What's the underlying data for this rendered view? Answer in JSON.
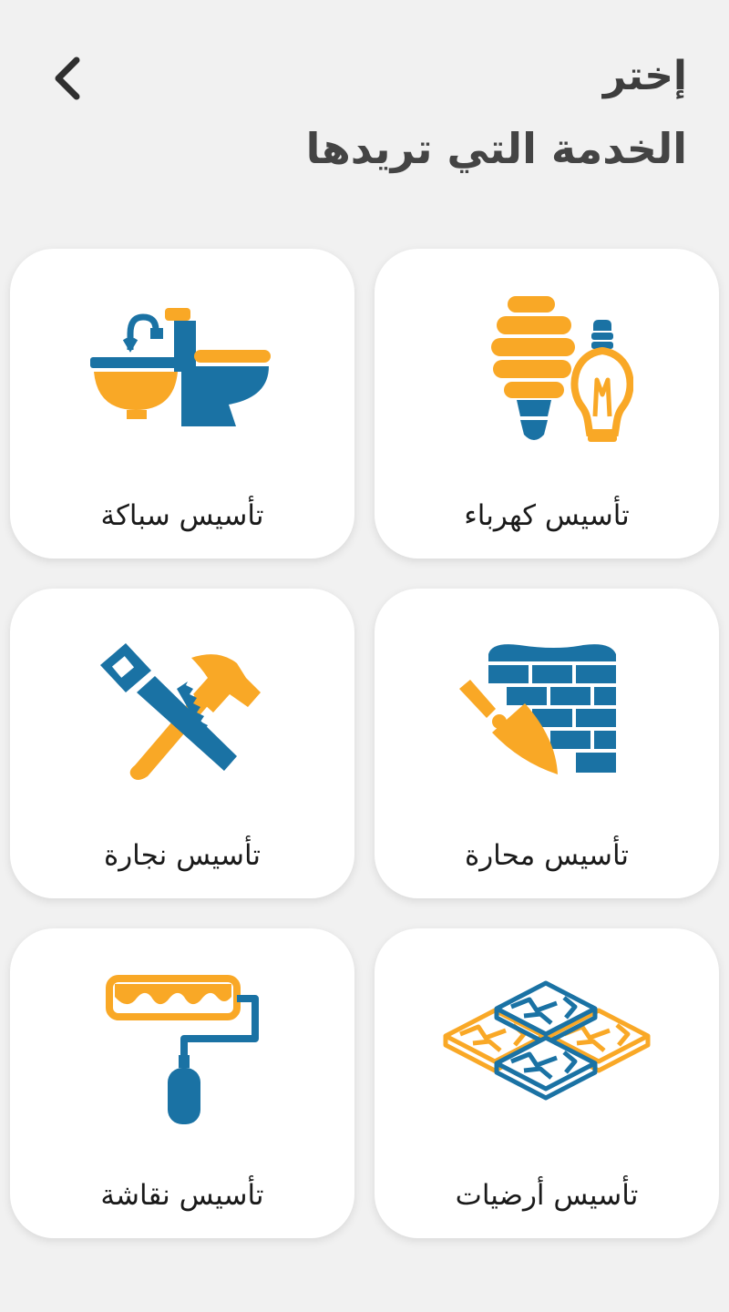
{
  "header": {
    "title_line1": "إختر",
    "title_line2": "الخدمة التي تريدها"
  },
  "colors": {
    "orange": "#f9a826",
    "blue": "#1a72a4",
    "title": "#444444",
    "background": "#f1f1f1"
  },
  "services": [
    {
      "label": "تأسيس كهرباء",
      "icon": "light-bulbs-icon"
    },
    {
      "label": "تأسيس سباكة",
      "icon": "sink-toilet-icon"
    },
    {
      "label": "تأسيس محارة",
      "icon": "trowel-bricks-icon"
    },
    {
      "label": "تأسيس نجارة",
      "icon": "saw-hammer-icon"
    },
    {
      "label": "تأسيس أرضيات",
      "icon": "floor-tiles-icon"
    },
    {
      "label": "تأسيس نقاشة",
      "icon": "paint-roller-icon"
    }
  ]
}
